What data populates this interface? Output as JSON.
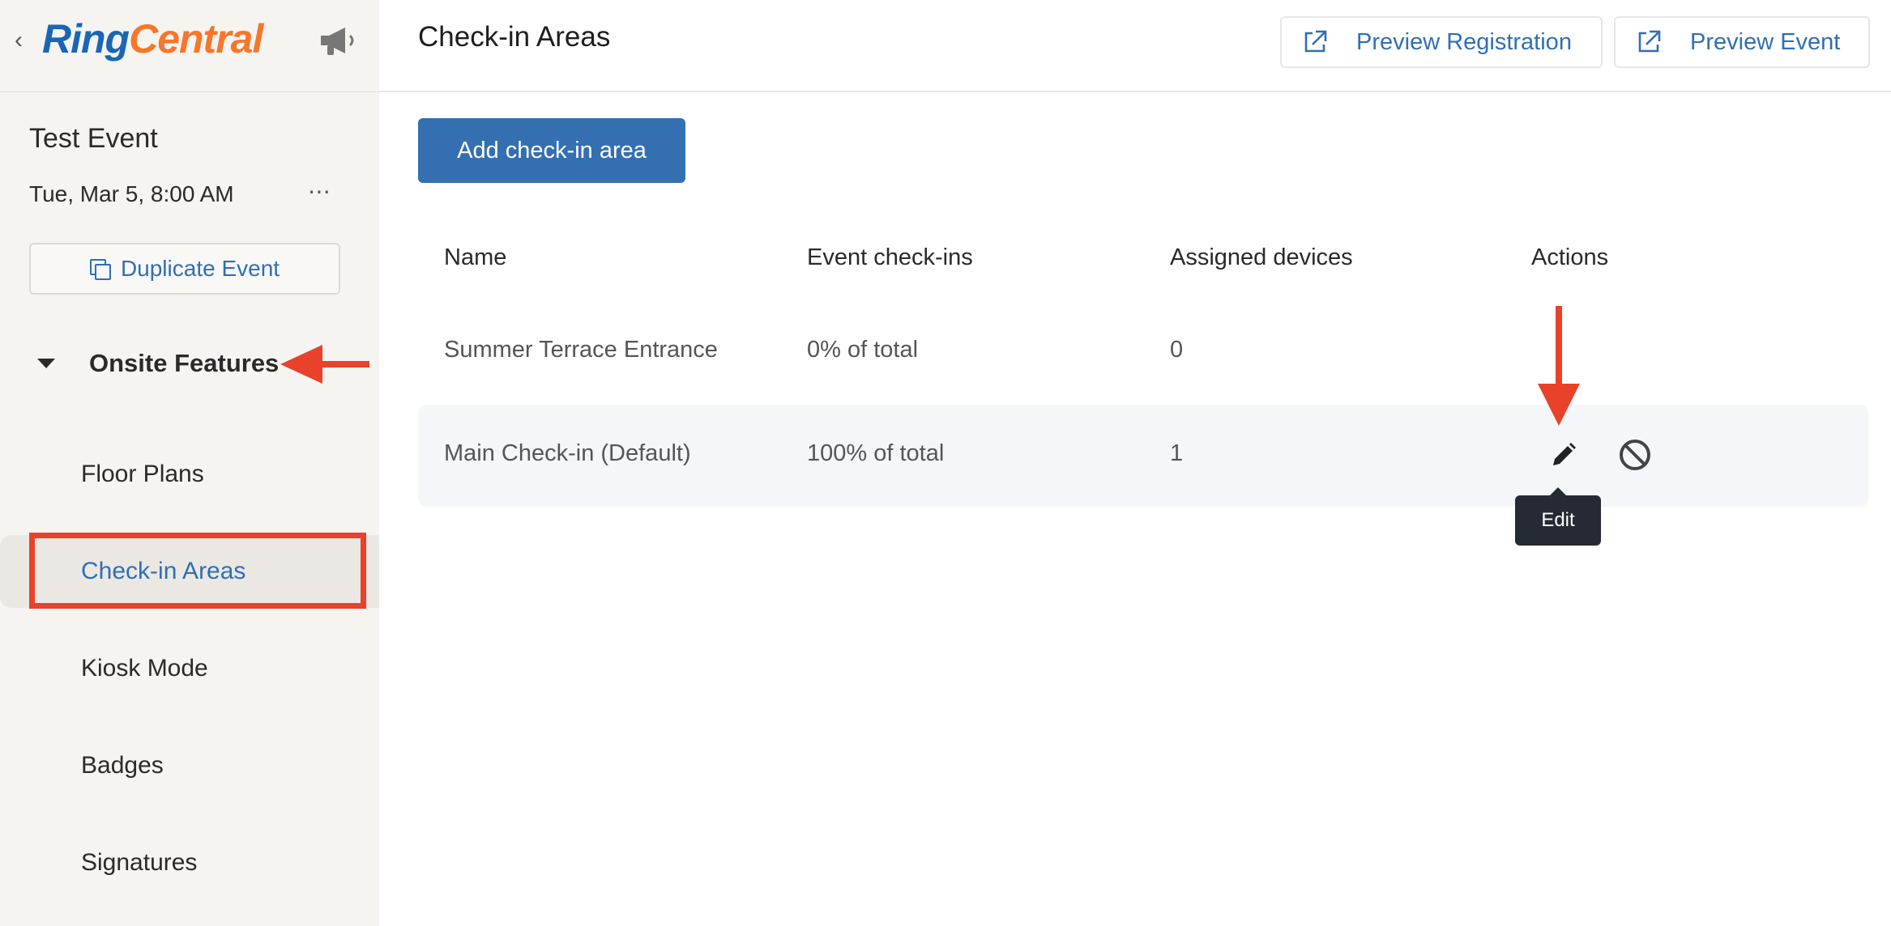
{
  "brand": {
    "logo_part1": "Ring",
    "logo_part2": "Central"
  },
  "sidebar": {
    "event_title": "Test Event",
    "event_date": "Tue, Mar 5, 8:00 AM",
    "more_label": "⋯",
    "duplicate_label": "Duplicate Event",
    "section_label": "Onsite Features",
    "items": [
      {
        "label": "Floor Plans"
      },
      {
        "label": "Check-in Areas"
      },
      {
        "label": "Kiosk Mode"
      },
      {
        "label": "Badges"
      },
      {
        "label": "Signatures"
      }
    ],
    "active_item": "Check-in Areas"
  },
  "header": {
    "title": "Check-in Areas",
    "preview_registration_label": "Preview Registration",
    "preview_event_label": "Preview Event"
  },
  "main": {
    "add_button_label": "Add check-in area",
    "columns": [
      "Name",
      "Event check-ins",
      "Assigned devices",
      "Actions"
    ],
    "rows": [
      {
        "name": "Summer Terrace Entrance",
        "checkins": "0% of total",
        "devices": "0"
      },
      {
        "name": "Main Check-in (Default)",
        "checkins": "100% of total",
        "devices": "1"
      }
    ],
    "tooltip_label": "Edit"
  },
  "colors": {
    "accent": "#2f6fb5",
    "primary_button": "#3470b1",
    "annotation": "#e8422a",
    "logo_blue": "#1a66b5",
    "logo_orange": "#f7762b"
  }
}
